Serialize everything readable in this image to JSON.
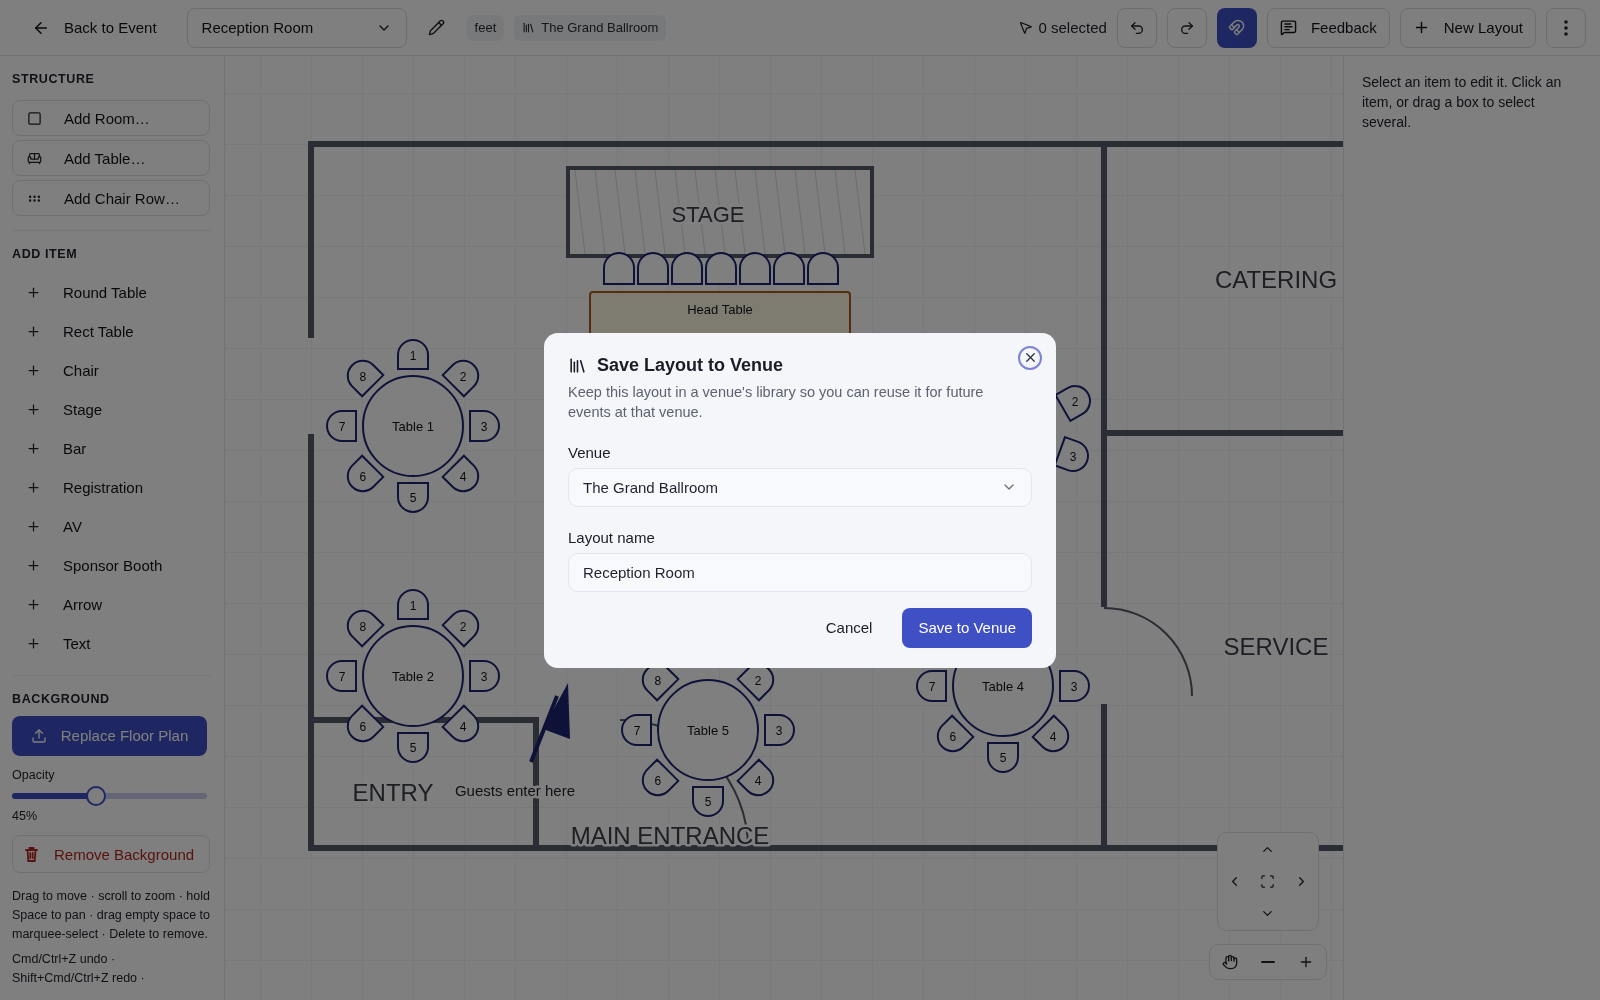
{
  "toolbar": {
    "back": "Back to Event",
    "layout": "Reception Room",
    "unit": "feet",
    "venue": "The Grand Ballroom",
    "selection": "0 selected",
    "snap_on": true,
    "feedback": "Feedback",
    "new_layout": "New Layout"
  },
  "sidebar": {
    "sections": [
      {
        "title": "STRUCTURE",
        "kind": "structure",
        "items": [
          "Add Room…",
          "Add Table…",
          "Add Chair Row…"
        ]
      },
      {
        "title": "ADD ITEM",
        "kind": "add",
        "items": [
          "Round Table",
          "Rect Table",
          "Chair",
          "Stage",
          "Bar",
          "Registration",
          "AV",
          "Sponsor Booth",
          "Arrow",
          "Text"
        ]
      }
    ],
    "background": {
      "title": "BACKGROUND",
      "replace": "Replace Floor Plan",
      "opacity_label": "Opacity",
      "opacity": {
        "level": 0.43
      },
      "opacity_reading": "45%",
      "remove": "Remove Background"
    },
    "help": [
      "Drag to move · scroll to zoom · hold Space to pan · drag empty space to marquee-select · Delete to remove.",
      "Cmd/Ctrl+Z undo · Shift+Cmd/Ctrl+Z redo ·"
    ]
  },
  "floor_plan": {
    "stage": "STAGE",
    "head_table": "Head Table",
    "rooms": [
      "CATERING",
      "SERVICE",
      "ENTRY",
      "MAIN ENTRANCE"
    ],
    "note": "Guests enter here",
    "tables": [
      {
        "label": "Table 1",
        "seats": [
          "1",
          "2",
          "3",
          "4",
          "5",
          "6",
          "7",
          "8"
        ]
      },
      {
        "label": "Table 2",
        "seats": [
          "1",
          "2",
          "3",
          "4",
          "5",
          "6",
          "7",
          "8"
        ]
      },
      {
        "seats": [
          "2",
          "3"
        ]
      },
      {
        "label": "Table 5",
        "seats": [
          "2",
          "3",
          "4",
          "5",
          "6",
          "7",
          "8"
        ]
      },
      {
        "label": "Table 4",
        "seats": [
          "3",
          "4",
          "5",
          "6",
          "7"
        ]
      }
    ]
  },
  "inspector": {
    "hint": "Select an item to edit it. Click an item, or drag a box to select several."
  },
  "dialog": {
    "title": "Save Layout to Venue",
    "description": "Keep this layout in a venue's library so you can reuse it for future events at that venue.",
    "venue_label": "Venue",
    "venue": "The Grand Ballroom",
    "name_label": "Layout name",
    "name": "Reception Room",
    "cancel": "Cancel",
    "save": "Save to Venue"
  }
}
